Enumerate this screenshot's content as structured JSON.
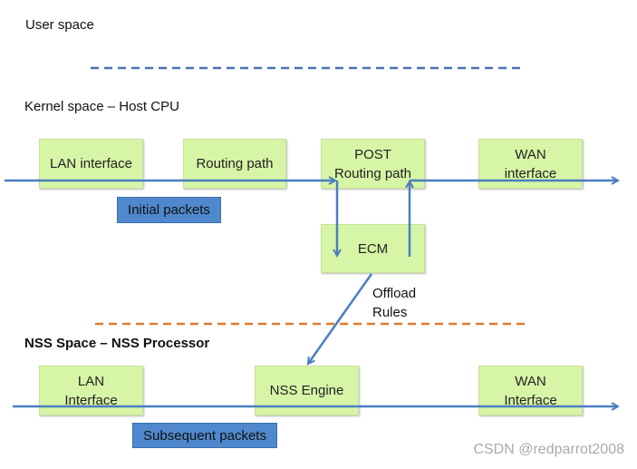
{
  "regions": {
    "user_space": "User space",
    "kernel_space": "Kernel space – Host CPU",
    "nss_space": "NSS Space – NSS Processor"
  },
  "kernel_boxes": {
    "lan": "LAN interface",
    "routing": "Routing path",
    "post_line1": "POST",
    "post_line2": "Routing path",
    "wan_line1": "WAN",
    "wan_line2": "interface",
    "ecm": "ECM"
  },
  "nss_boxes": {
    "lan_line1": "LAN",
    "lan_line2": "Interface",
    "engine": "NSS Engine",
    "wan_line1": "WAN",
    "wan_line2": "Interface"
  },
  "labels": {
    "initial": "Initial packets",
    "subsequent": "Subsequent packets",
    "offload_line1": "Offload",
    "offload_line2": "Rules"
  },
  "watermark": "CSDN @redparrot2008",
  "colors": {
    "box": "#d7f5a6",
    "label": "#4f88cc",
    "arrow": "#4a7ebf",
    "kernel_divider": "#4a72b0",
    "nss_divider": "#e07a2e"
  }
}
